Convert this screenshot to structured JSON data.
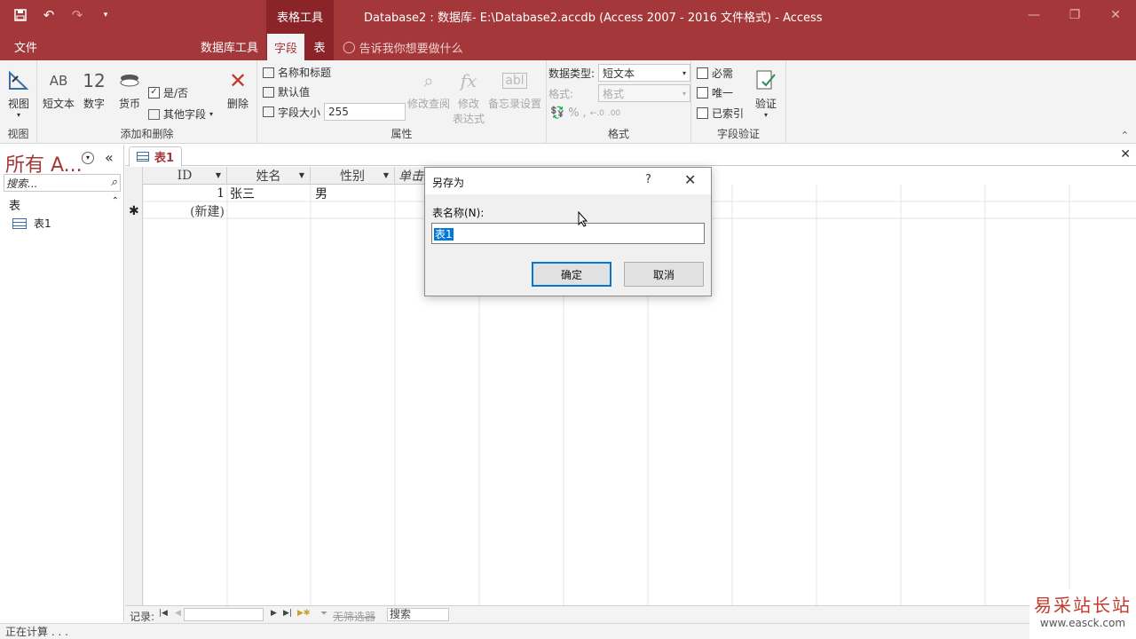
{
  "titlebar": {
    "context_group": "表格工具",
    "window_title": "Database2 : 数据库- E:\\Database2.accdb (Access 2007 - 2016 文件格式)  -  Access",
    "colors": {
      "accent": "#a4373a",
      "context": "#8a2428"
    }
  },
  "tabs": {
    "file": "文件",
    "db_tools": "数据库工具",
    "field": "字段",
    "table": "表",
    "tell_me": "告诉我你想要做什么"
  },
  "ribbon": {
    "views": {
      "view_label": "视图",
      "group_label": "视图"
    },
    "add_delete": {
      "short_text": "短文本",
      "number": "数字",
      "currency": "货币",
      "yes_no": "是/否",
      "more_fields": "其他字段",
      "delete": "删除",
      "group_label": "添加和删除"
    },
    "properties": {
      "name_caption": "名称和标题",
      "default_value": "默认值",
      "field_size_label": "字段大小",
      "field_size_value": "255",
      "modify_lookups": "修改查阅",
      "modify_expression": "修改",
      "modify_expression_2": "表达式",
      "memo_settings": "备忘录设置",
      "group_label": "属性"
    },
    "formatting": {
      "data_type_label": "数据类型:",
      "data_type_value": "短文本",
      "format_label": "格式:",
      "format_value": "格式",
      "group_label": "格式"
    },
    "validation": {
      "required": "必需",
      "unique": "唯一",
      "indexed": "已索引",
      "validation": "验证",
      "group_label": "字段验证"
    }
  },
  "nav": {
    "title": "所有 A...",
    "search_placeholder": "搜索...",
    "section": "表",
    "items": [
      {
        "label": "表1"
      }
    ]
  },
  "document": {
    "tab_label": "表1",
    "columns": [
      "ID",
      "姓名",
      "性别",
      "单击"
    ],
    "rows": [
      {
        "id": "1",
        "name": "张三",
        "gender": "男"
      }
    ],
    "new_row": "(新建)"
  },
  "recnav": {
    "label": "记录:",
    "filter": "无筛选器",
    "search": "搜索"
  },
  "status": {
    "text": "正在计算 . . ."
  },
  "dialog": {
    "title": "另存为",
    "help": "?",
    "label": "表名称(N):",
    "value": "表1",
    "ok": "确定",
    "cancel": "取消"
  },
  "watermark": {
    "cn": "易采站长站",
    "url": "www.easck.com"
  }
}
